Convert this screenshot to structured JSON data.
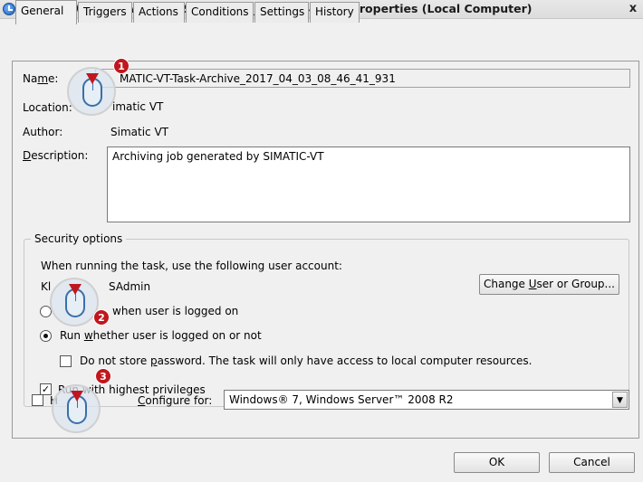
{
  "window": {
    "title": "SIMATIC-VT-Task-Archive_2017_04_03_08_46_41_931 Properties (Local Computer)",
    "close_glyph": "x"
  },
  "tabs": [
    {
      "label": "General",
      "active": true
    },
    {
      "label": "Triggers",
      "active": false
    },
    {
      "label": "Actions",
      "active": false
    },
    {
      "label": "Conditions",
      "active": false
    },
    {
      "label": "Settings",
      "active": false
    },
    {
      "label": "History",
      "active": false
    }
  ],
  "general": {
    "name_label": "Name:",
    "name_value": "SIMATIC-VT-Task-Archive_2017_04_03_08_46_41_931",
    "name_visible": "MATIC-VT-Task-Archive_2017_04_03_08_46_41_931",
    "location_label": "Location:",
    "location_value": "Simatic VT",
    "location_visible": "imatic VT",
    "author_label": "Author:",
    "author_value": "Simatic VT",
    "description_label": "Description:",
    "description_value": "Archiving job generated by SIMATIC-VT"
  },
  "security": {
    "title": "Security options",
    "account_prompt": "When running the task, use the following user account:",
    "account_prefix": "Kl",
    "account_suffix": "SAdmin",
    "change_user_button": "Change User or Group...",
    "radio_logged_on": "when user is logged on",
    "radio_logged_on_checked": false,
    "radio_whether": "Run whether user is logged on or not",
    "radio_whether_checked": true,
    "no_store_password": "Do not store password.  The task will only have access to local computer resources.",
    "no_store_password_checked": false,
    "highest_privileges": "Run with highest privileges",
    "highest_privileges_checked": true
  },
  "bottom": {
    "hidden_prefix": "H",
    "hidden_checked": false,
    "configure_label": "Configure for:",
    "configure_value": "Windows® 7, Windows Server™ 2008 R2",
    "ok_button": "OK",
    "cancel_button": "Cancel"
  },
  "callouts": [
    {
      "number": "1"
    },
    {
      "number": "2"
    },
    {
      "number": "3"
    }
  ],
  "colors": {
    "callout_badge": "#c0171f",
    "mouse_outline": "#3a6fa8"
  }
}
